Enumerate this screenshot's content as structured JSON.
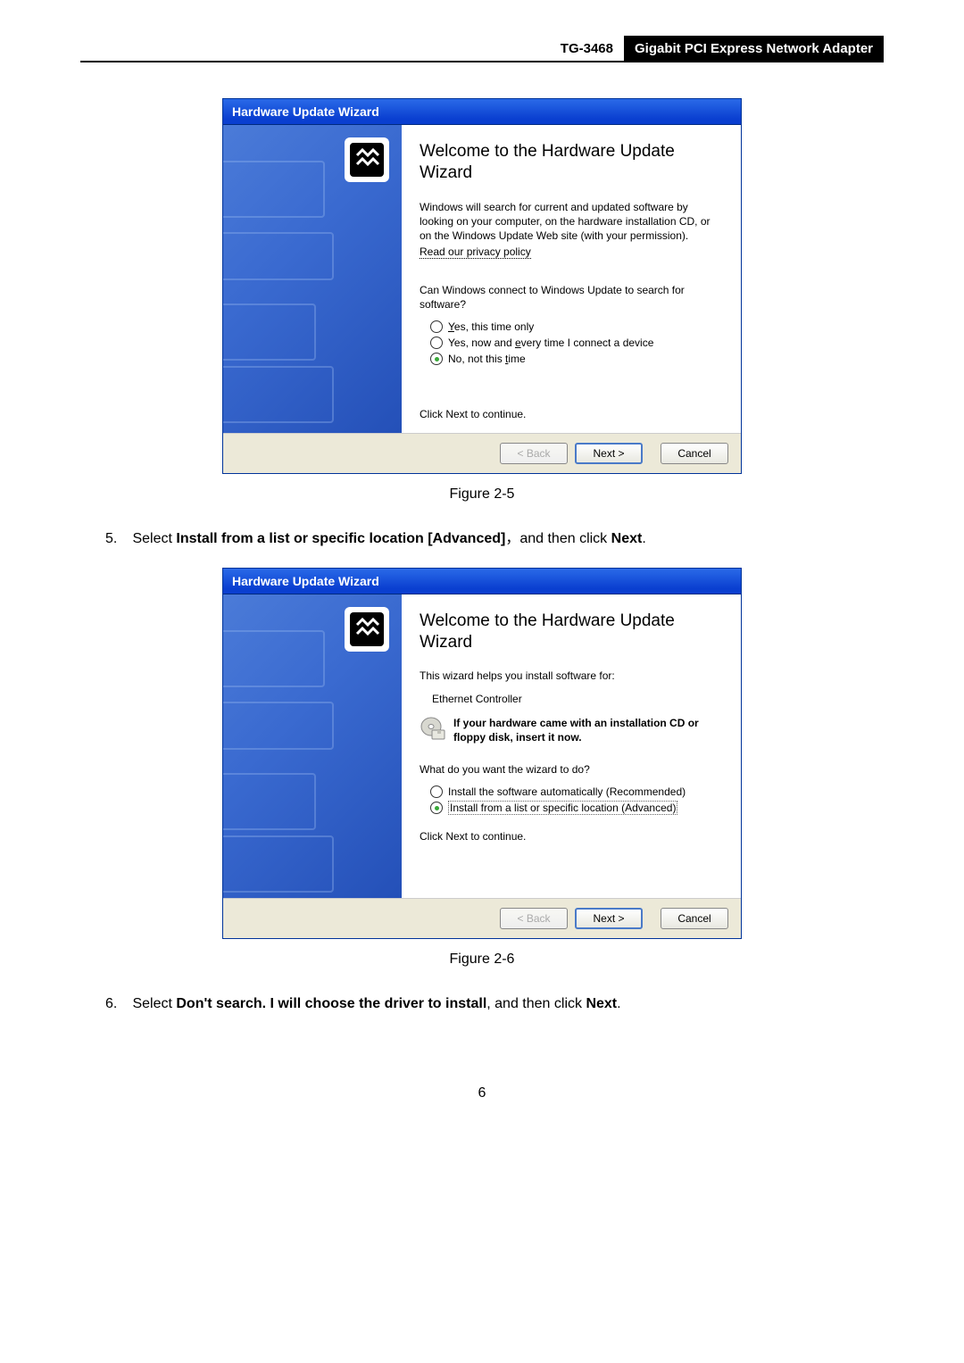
{
  "header": {
    "model": "TG-3468",
    "product": "Gigabit PCI Express Network Adapter"
  },
  "dialog1": {
    "title": "Hardware Update Wizard",
    "heading": "Welcome to the Hardware Update Wizard",
    "intro1": "Windows will search for current and updated software by looking on your computer, on the hardware installation CD, or on the Windows Update Web site (with your permission).",
    "privacy": "Read our privacy policy",
    "question": "Can Windows connect to Windows Update to search for software?",
    "opt1_pre": "Y",
    "opt1_rest": "es, this time only",
    "opt2_pre": "Yes, now and ",
    "opt2_mid": "e",
    "opt2_rest": "very time I connect a device",
    "opt3_pre": "No, not this ",
    "opt3_mid": "t",
    "opt3_rest": "ime",
    "continue": "Click Next to continue.",
    "back": "< Back",
    "next": "Next >",
    "cancel": "Cancel"
  },
  "caption1": "Figure 2-5",
  "step5_num": "5.",
  "step5_a": "Select ",
  "step5_b": "Install from a list or specific location [Advanced]",
  "step5_c": "，and then click ",
  "step5_d": "Next",
  "step5_e": ".",
  "dialog2": {
    "title": "Hardware Update Wizard",
    "heading": "Welcome to the Hardware Update Wizard",
    "intro": "This wizard helps you install software for:",
    "device": "Ethernet Controller",
    "note": "If your hardware came with an installation CD or floppy disk, insert it now.",
    "question": "What do you want the wizard to do?",
    "opt1": "Install the software automatically (Recommended)",
    "opt2": "Install from a list or specific location (Advanced)",
    "continue": "Click Next to continue.",
    "back": "< Back",
    "next": "Next >",
    "cancel": "Cancel"
  },
  "caption2": "Figure 2-6",
  "step6_num": "6.",
  "step6_a": "Select ",
  "step6_b": "Don't search. I will choose the driver to install",
  "step6_c": ", and then click ",
  "step6_d": "Next",
  "step6_e": ".",
  "pagenum": "6"
}
